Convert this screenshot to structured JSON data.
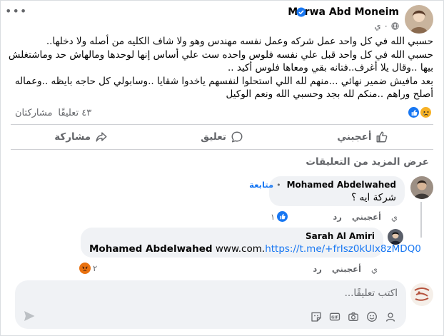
{
  "post": {
    "author": "Marwa Abd Moneim",
    "time": "٠ ي",
    "lines": [
      "حسبي الله في كل واحد عمل شركه  وعمل نفسه مهندس وهو ولا شاف الكليه من أصله ولا دخلها..",
      "حسبي الله في كل واحد قبل علي  نفسه فلوس واحده ست علي أساس إنها لوحدها ومالهاش حد وماشتغلش بيها ..وقال يلا أغرف..فتانه بقي ومعاها فلوس أكيد ..",
      "بعد مافيش ضمير نهائي ...منهم لله اللي استحلوا لنفسهم ياخدوا شقايا ..وسابولي كل حاجه بايظه ..وعماله أصلح وراهم ..منكم لله بجد وحسبي الله ونعم الوكيل"
    ],
    "comments_count": "٤٣ تعليقًا",
    "shares_label": "مشاركتان",
    "reaction_icons": [
      "like-icon",
      "sad-icon"
    ]
  },
  "actions": {
    "like": "أعجبني",
    "comment": "تعليق",
    "share": "مشاركة"
  },
  "more_comments": "عرض المزيد من التعليقات",
  "comments": [
    {
      "name": "Mohamed Abdelwahed",
      "follow": "متابعة",
      "text": "شركة ايه ؟",
      "time": "ي",
      "like": "أعجبني",
      "reply": "رد",
      "reaction_count": "١",
      "reaction_icon": "like-icon"
    },
    {
      "name": "Sarah Al Amiri",
      "text_prefix": "Mohamed Abdelwahed",
      "text_plain": " www.com.",
      "text_link": "https://t.me/+frIsz0kUlx8zMDQ0",
      "time": "ي",
      "like": "أعجبني",
      "reply": "رد",
      "reaction_count": "٢",
      "reaction_icon": "angry-icon"
    }
  ],
  "composer": {
    "placeholder": "اكتب تعليقًا..."
  },
  "colors": {
    "accent": "#1877f2",
    "muted": "#65676b",
    "bubble": "#f0f2f5",
    "like": "#1877f2",
    "sad": "#f7b125",
    "angry": "#e9710f"
  }
}
